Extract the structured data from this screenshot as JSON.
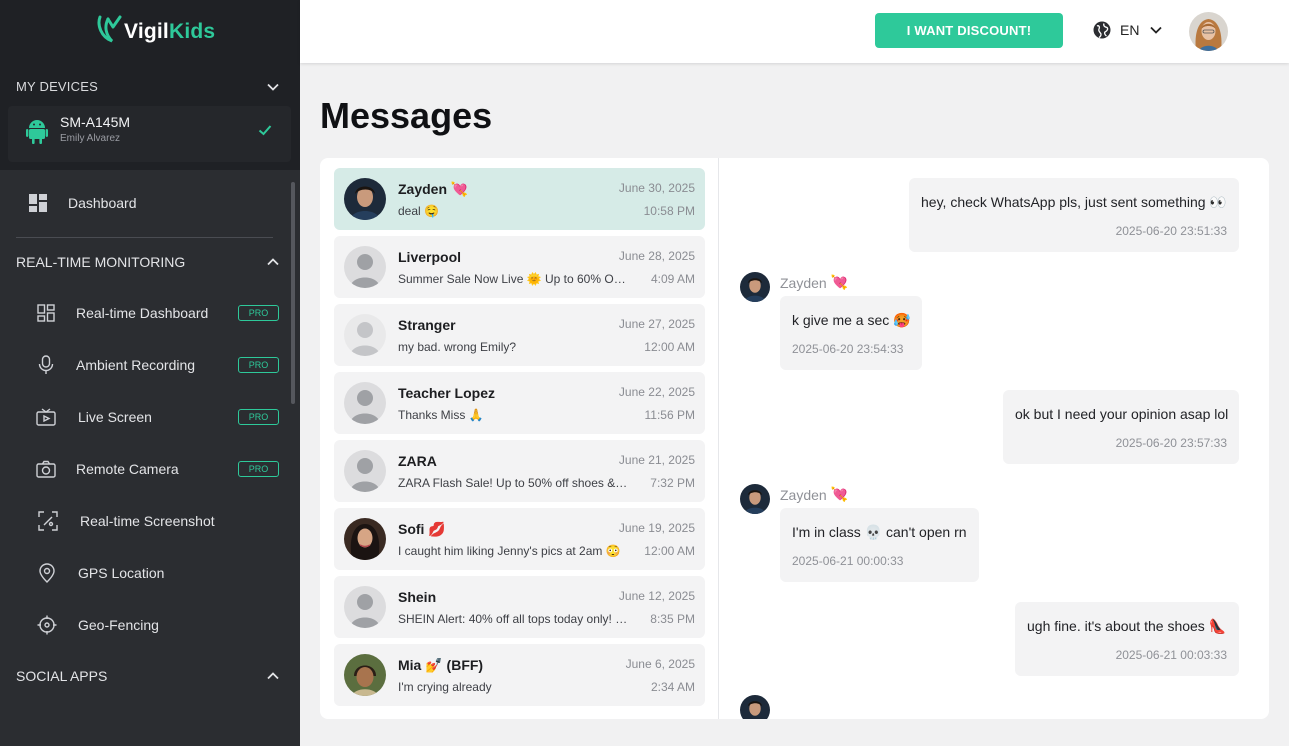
{
  "app": {
    "logo_prefix": "Vigil",
    "logo_suffix": "Kids",
    "brand_color": "#2ec99a"
  },
  "sidebar": {
    "my_devices_label": "MY DEVICES",
    "device": {
      "name": "SM-A145M",
      "owner": "Emily Alvarez",
      "icon": "android-icon",
      "selected": true
    },
    "dashboard_label": "Dashboard",
    "realtime_section_label": "REAL-TIME MONITORING",
    "items": [
      {
        "label": "Real-time Dashboard",
        "icon": "grid-dashboard-icon",
        "badge": "PRO"
      },
      {
        "label": "Ambient Recording",
        "icon": "microphone-icon",
        "badge": "PRO"
      },
      {
        "label": "Live Screen",
        "icon": "tv-play-icon",
        "badge": "PRO"
      },
      {
        "label": "Remote Camera",
        "icon": "camera-icon",
        "badge": "PRO"
      },
      {
        "label": "Real-time Screenshot",
        "icon": "screenshot-icon",
        "badge": ""
      },
      {
        "label": "GPS Location",
        "icon": "map-pin-icon",
        "badge": ""
      },
      {
        "label": "Geo-Fencing",
        "icon": "crosshair-icon",
        "badge": ""
      }
    ],
    "social_section_label": "SOCIAL APPS"
  },
  "header": {
    "discount_label": "I WANT DISCOUNT!",
    "language_code": "EN",
    "language_icon": "globe-icon"
  },
  "page": {
    "title": "Messages"
  },
  "conversations": [
    {
      "name": "Zayden",
      "emoji": "💘",
      "date": "June 30, 2025",
      "preview": "deal 🤤",
      "time": "10:58 PM",
      "avatar": "photo-boy",
      "active": true
    },
    {
      "name": "Liverpool",
      "emoji": "",
      "date": "June 28, 2025",
      "preview": "Summer Sale Now Live 🌞 Up to 60% Off…",
      "time": "4:09 AM",
      "avatar": "placeholder",
      "active": false
    },
    {
      "name": "Stranger",
      "emoji": "",
      "date": "June 27, 2025",
      "preview": "my bad. wrong Emily?",
      "time": "12:00 AM",
      "avatar": "placeholder-light",
      "active": false
    },
    {
      "name": "Teacher Lopez",
      "emoji": "",
      "date": "June 22, 2025",
      "preview": "Thanks Miss 🙏",
      "time": "11:56 PM",
      "avatar": "placeholder",
      "active": false
    },
    {
      "name": "ZARA",
      "emoji": "",
      "date": "June 21, 2025",
      "preview": "ZARA Flash Sale! Up to 50% off shoes & bag…",
      "time": "7:32 PM",
      "avatar": "placeholder",
      "active": false
    },
    {
      "name": "Sofi",
      "emoji": "💋",
      "date": "June 19, 2025",
      "preview": "I caught him liking Jenny's pics at 2am 😳",
      "time": "12:00 AM",
      "avatar": "photo-girl",
      "active": false
    },
    {
      "name": "Shein",
      "emoji": "",
      "date": "June 12, 2025",
      "preview": "SHEIN Alert: 40% off all tops today only! Use…",
      "time": "8:35 PM",
      "avatar": "placeholder",
      "active": false
    },
    {
      "name": "Mia",
      "emoji": "💅 (BFF)",
      "date": "June 6, 2025",
      "preview": "I'm crying already",
      "time": "2:34 AM",
      "avatar": "photo-kid",
      "active": false
    }
  ],
  "messages": [
    {
      "direction": "out",
      "text": "hey, check WhatsApp pls, just sent something 👀",
      "time": "2025-06-20 23:51:33"
    },
    {
      "direction": "in",
      "sender": "Zayden",
      "sender_emoji": "💘",
      "text": "k give me a sec 🥵",
      "time": "2025-06-20 23:54:33"
    },
    {
      "direction": "out",
      "text": "ok but I need your opinion asap lol",
      "time": "2025-06-20 23:57:33"
    },
    {
      "direction": "in",
      "sender": "Zayden",
      "sender_emoji": "💘",
      "text": "I'm in class 💀 can't open rn",
      "time": "2025-06-21 00:00:33"
    },
    {
      "direction": "out",
      "text": "ugh fine. it's about the shoes 👠",
      "time": "2025-06-21 00:03:33"
    }
  ]
}
